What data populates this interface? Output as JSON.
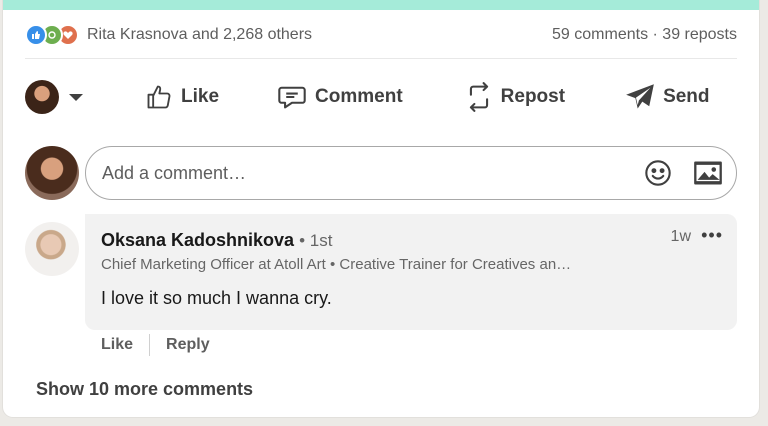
{
  "social": {
    "reactors": "Rita Krasnova and 2,268 others",
    "counts": "59 comments · 39 reposts",
    "reaction_icons": [
      "like-icon",
      "celebrate-icon",
      "love-icon"
    ]
  },
  "actions": {
    "like": "Like",
    "comment": "Comment",
    "repost": "Repost",
    "send": "Send"
  },
  "composer": {
    "placeholder": "Add a comment…"
  },
  "comment": {
    "author": "Oksana Kadoshnikova",
    "degree": "• 1st",
    "headline": "Chief Marketing Officer at Atoll Art • Creative Trainer for Creatives an…",
    "time": "1w",
    "more": "•••",
    "text": "I love it so much I wanna cry.",
    "like_label": "Like",
    "reply_label": "Reply"
  },
  "show_more": "Show 10 more comments",
  "colors": {
    "accent_strip": "#a5ebd9",
    "like": "#378fe9",
    "celebrate": "#6dae4f",
    "love": "#df704d"
  }
}
